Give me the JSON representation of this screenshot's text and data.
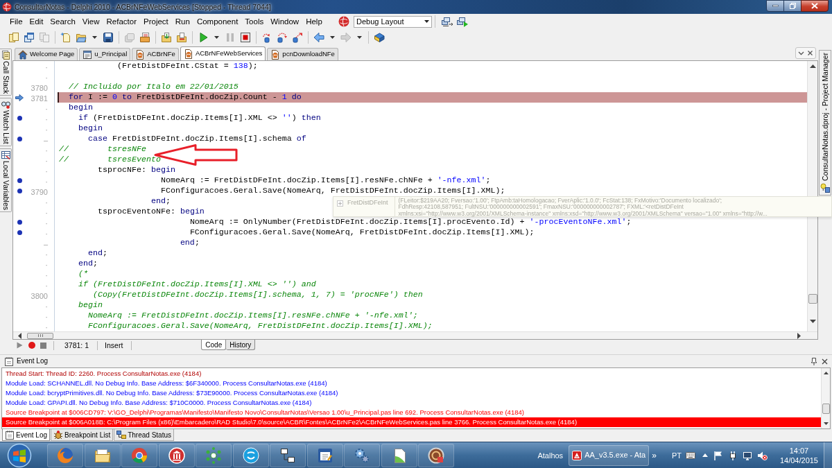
{
  "window": {
    "title": "ConsultarNotas - Delphi 2010 - ACBrNFeWebServices [Stopped - Thread 7044]"
  },
  "menu": [
    "File",
    "Edit",
    "Search",
    "View",
    "Refactor",
    "Project",
    "Run",
    "Component",
    "Tools",
    "Window",
    "Help"
  ],
  "layout_dropdown": {
    "value": "Debug Layout"
  },
  "toolbar_groups": [
    {
      "items": [
        {
          "kind": "pages",
          "disabled": false
        },
        {
          "kind": "windows",
          "disabled": false
        },
        {
          "kind": "page",
          "disabled": true
        }
      ]
    },
    {
      "items": [
        {
          "kind": "new",
          "disabled": false
        },
        {
          "kind": "folder",
          "disabled": false
        },
        {
          "kind": "caret",
          "disabled": false
        },
        {
          "kind": "disk",
          "disabled": false
        }
      ]
    },
    {
      "items": [
        {
          "kind": "stack",
          "disabled": true
        },
        {
          "kind": "browse",
          "disabled": false
        }
      ]
    },
    {
      "items": [
        {
          "kind": "add",
          "disabled": false
        },
        {
          "kind": "remove",
          "disabled": false
        }
      ]
    },
    {
      "items": [
        {
          "kind": "run",
          "disabled": false
        },
        {
          "kind": "caret",
          "disabled": false
        },
        {
          "kind": "pause",
          "disabled": true
        },
        {
          "kind": "stop",
          "disabled": false
        }
      ]
    },
    {
      "items": [
        {
          "kind": "into",
          "disabled": false
        },
        {
          "kind": "over",
          "disabled": false
        },
        {
          "kind": "out",
          "disabled": false
        }
      ]
    },
    {
      "items": [
        {
          "kind": "back",
          "disabled": false
        },
        {
          "kind": "caret",
          "disabled": false
        },
        {
          "kind": "forward",
          "disabled": true
        },
        {
          "kind": "caret",
          "disabled": false
        }
      ]
    },
    {
      "items": [
        {
          "kind": "book",
          "disabled": false
        }
      ]
    }
  ],
  "left_dock": [
    {
      "label": "Call Stack"
    },
    {
      "label": "Watch List"
    },
    {
      "label": "Local Variables"
    }
  ],
  "right_dock": [
    {
      "label": "ConsultarNotas.dproj - Project Manager"
    }
  ],
  "editor_tabs": [
    {
      "label": "Welcome Page",
      "kind": "home",
      "selected": false
    },
    {
      "label": "u_Principal",
      "kind": "form",
      "selected": false
    },
    {
      "label": "ACBrNFe",
      "kind": "unit",
      "selected": false
    },
    {
      "label": "ACBrNFeWebServices",
      "kind": "unit",
      "selected": true
    },
    {
      "label": "pcnDownloadNFe",
      "kind": "unit",
      "selected": false
    }
  ],
  "editor": {
    "lines": [
      {
        "gutter": "·",
        "compiled": false,
        "current": false,
        "code": [
          {
            "kind": "text",
            "text": "            (FretDistDFeInt.CStat = "
          },
          {
            "kind": "number",
            "text": "138"
          },
          {
            "kind": "text",
            "text": ");"
          }
        ]
      },
      {
        "gutter": "·",
        "compiled": false,
        "current": false
      },
      {
        "gutter": "3780",
        "compiled": false,
        "current": false,
        "code": [
          {
            "kind": "comment",
            "text": "  // Incluido por Italo em 22/01/2015"
          }
        ]
      },
      {
        "gutter": "3781",
        "compiled": false,
        "current": true,
        "code": [
          {
            "kind": "keyword",
            "text": "  for"
          },
          {
            "kind": "text",
            "text": " I := "
          },
          {
            "kind": "number",
            "text": "0"
          },
          {
            "kind": "keyword",
            "text": " to"
          },
          {
            "kind": "text",
            "text": " FretDistDFeInt.docZip.Count - "
          },
          {
            "kind": "number",
            "text": "1"
          },
          {
            "kind": "keyword",
            "text": " do"
          }
        ]
      },
      {
        "gutter": "·",
        "compiled": false,
        "current": false,
        "code": [
          {
            "kind": "keyword",
            "text": "  begin"
          }
        ]
      },
      {
        "gutter": "·",
        "compiled": true,
        "current": false,
        "code": [
          {
            "kind": "keyword",
            "text": "    if"
          },
          {
            "kind": "text",
            "text": " (FretDistDFeInt.docZip.Items[I].XML <> "
          },
          {
            "kind": "string",
            "text": "''"
          },
          {
            "kind": "text",
            "text": ") "
          },
          {
            "kind": "keyword",
            "text": "then"
          }
        ]
      },
      {
        "gutter": "·",
        "compiled": false,
        "current": false,
        "code": [
          {
            "kind": "keyword",
            "text": "    begin"
          }
        ]
      },
      {
        "gutter": "–",
        "compiled": true,
        "current": false,
        "code": [
          {
            "kind": "keyword",
            "text": "      case"
          },
          {
            "kind": "text",
            "text": " FretDistDFeInt.docZip.Items[I].schema "
          },
          {
            "kind": "keyword",
            "text": "of"
          }
        ]
      },
      {
        "gutter": "·",
        "compiled": false,
        "current": false,
        "code": [
          {
            "kind": "comment",
            "text": "//        tsresNFe"
          }
        ]
      },
      {
        "gutter": "·",
        "compiled": false,
        "current": false,
        "code": [
          {
            "kind": "comment",
            "text": "//        tsresEvento"
          }
        ]
      },
      {
        "gutter": "·",
        "compiled": false,
        "current": false,
        "code": [
          {
            "kind": "text",
            "text": "        tsprocNFe: "
          },
          {
            "kind": "keyword",
            "text": "begin"
          }
        ]
      },
      {
        "gutter": "·",
        "compiled": true,
        "current": false,
        "code": [
          {
            "kind": "text",
            "text": "                     NomeArq := FretDistDFeInt.docZip.Items[I].resNFe.chNFe + "
          },
          {
            "kind": "string",
            "text": "'-nfe.xml'"
          },
          {
            "kind": "text",
            "text": ";"
          }
        ]
      },
      {
        "gutter": "3790",
        "compiled": true,
        "current": false,
        "code": [
          {
            "kind": "text",
            "text": "                     FConfiguracoes.Geral.Save(NomeArq, FretDistDFeInt.docZip.Items[I].XML);"
          }
        ]
      },
      {
        "gutter": "·",
        "compiled": false,
        "current": false,
        "code": [
          {
            "kind": "keyword",
            "text": "                   end"
          },
          {
            "kind": "text",
            "text": ";"
          }
        ]
      },
      {
        "gutter": "·",
        "compiled": false,
        "current": false,
        "code": [
          {
            "kind": "text",
            "text": "        tsprocEventoNFe: "
          },
          {
            "kind": "keyword",
            "text": "begin"
          }
        ]
      },
      {
        "gutter": "·",
        "compiled": true,
        "current": false,
        "code": [
          {
            "kind": "text",
            "text": "                           NomeArq := OnlyNumber(FretDistDFeInt.docZip.Items[I].procEvento.Id) + "
          },
          {
            "kind": "string",
            "text": "'-procEventoNFe.xml'"
          },
          {
            "kind": "text",
            "text": ";"
          }
        ]
      },
      {
        "gutter": "·",
        "compiled": true,
        "current": false,
        "code": [
          {
            "kind": "text",
            "text": "                           FConfiguracoes.Geral.Save(NomeArq, FretDistDFeInt.docZip.Items[I].XML);"
          }
        ]
      },
      {
        "gutter": "–",
        "compiled": false,
        "current": false,
        "code": [
          {
            "kind": "keyword",
            "text": "                         end"
          },
          {
            "kind": "text",
            "text": ";"
          }
        ]
      },
      {
        "gutter": "·",
        "compiled": false,
        "current": false,
        "code": [
          {
            "kind": "keyword",
            "text": "      end"
          },
          {
            "kind": "text",
            "text": ";"
          }
        ]
      },
      {
        "gutter": "·",
        "compiled": false,
        "current": false,
        "code": [
          {
            "kind": "keyword",
            "text": "    end"
          },
          {
            "kind": "text",
            "text": ";"
          }
        ]
      },
      {
        "gutter": "·",
        "compiled": false,
        "current": false,
        "code": [
          {
            "kind": "comment",
            "text": "    (*"
          }
        ]
      },
      {
        "gutter": "·",
        "compiled": false,
        "current": false,
        "code": [
          {
            "kind": "comment",
            "text": "    if (FretDistDFeInt.docZip.Items[I].XML <> '') and"
          }
        ]
      },
      {
        "gutter": "3800",
        "compiled": false,
        "current": false,
        "code": [
          {
            "kind": "comment",
            "text": "       (Copy(FretDistDFeInt.docZip.Items[I].schema, 1, 7) = 'procNFe') then"
          }
        ]
      },
      {
        "gutter": "·",
        "compiled": false,
        "current": false,
        "code": [
          {
            "kind": "comment",
            "text": "    begin"
          }
        ]
      },
      {
        "gutter": "·",
        "compiled": false,
        "current": false,
        "code": [
          {
            "kind": "comment",
            "text": "      NomeArq := FretDistDFeInt.docZip.Items[I].resNFe.chNFe + '-nfe.xml';"
          }
        ]
      },
      {
        "gutter": "·",
        "compiled": false,
        "current": false,
        "code": [
          {
            "kind": "comment",
            "text": "      FConfiguracoes.Geral.Save(NomeArq, FretDistDFeInt.docZip.Items[I].XML);"
          }
        ]
      }
    ]
  },
  "debug_hint": {
    "expanded": false,
    "name": "FretDistDFeInt",
    "value_lines": [
      "(FLeitor:$219AA20; Fversao:'1.00'; FtpAmb:taHomologacao; FverAplic:'1.0.0'; FcStat:138; FxMotivo:'Documento localizado';",
      "FdhResp:42108,587951; FultNSU:'000000000002591'; FmaxNSU:'000000000002787'; FXML:'<retDistDFeInt",
      "xmlns:xsi=\"http://www.w3.org/2001/XMLSchema-instance\" xmlns:xsd=\"http://www.w3.org/2001/XMLSchema\" versao=\"1.00\" xmlns=\"http://w..."
    ]
  },
  "status_bar": {
    "position": "3781: 1",
    "mode": "Insert",
    "view_tabs": [
      {
        "label": "Code",
        "selected": true
      },
      {
        "label": "History",
        "selected": false
      }
    ]
  },
  "event_log": {
    "title": "Event Log",
    "entries": [
      {
        "kind": "thread",
        "text": "Thread Start: Thread ID: 2260. Process ConsultarNotas.exe (4184)",
        "selected": false
      },
      {
        "kind": "module",
        "text": "Module Load: SCHANNEL.dll. No Debug Info. Base Address: $6F340000. Process ConsultarNotas.exe (4184)",
        "selected": false
      },
      {
        "kind": "module",
        "text": "Module Load: bcryptPrimitives.dll. No Debug Info. Base Address: $73E90000. Process ConsultarNotas.exe (4184)",
        "selected": false
      },
      {
        "kind": "module",
        "text": "Module Load: GPAPI.dll. No Debug Info. Base Address: $710C0000. Process ConsultarNotas.exe (4184)",
        "selected": false
      },
      {
        "kind": "breakpoint",
        "text": "Source Breakpoint at $006CD797: V:\\GO_Delphi\\Programas\\Manifesto\\Manifesto Novo\\ConsultarNotas\\Versao 1.00\\u_Principal.pas line 692. Process ConsultarNotas.exe (4184)",
        "selected": false
      },
      {
        "kind": "breakpoint",
        "text": "Source Breakpoint at $006A018B: C:\\Program Files (x86)\\Embarcadero\\RAD Studio\\7.0\\source\\ACBR\\Fontes\\ACBrNFe2\\ACBrNFeWebServices.pas line 3766. Process ConsultarNotas.exe (4184)",
        "selected": true
      }
    ]
  },
  "bottom_tabs": [
    {
      "label": "Event Log",
      "selected": true
    },
    {
      "label": "Breakpoint List",
      "selected": false
    },
    {
      "label": "Thread Status",
      "selected": false
    }
  ],
  "taskbar": {
    "toolbar_label": "Atalhos",
    "task": "AA_v3.5.exe - Ata",
    "overflow": "»",
    "language": "PT",
    "time": "14:07",
    "date": "14/04/2015"
  }
}
